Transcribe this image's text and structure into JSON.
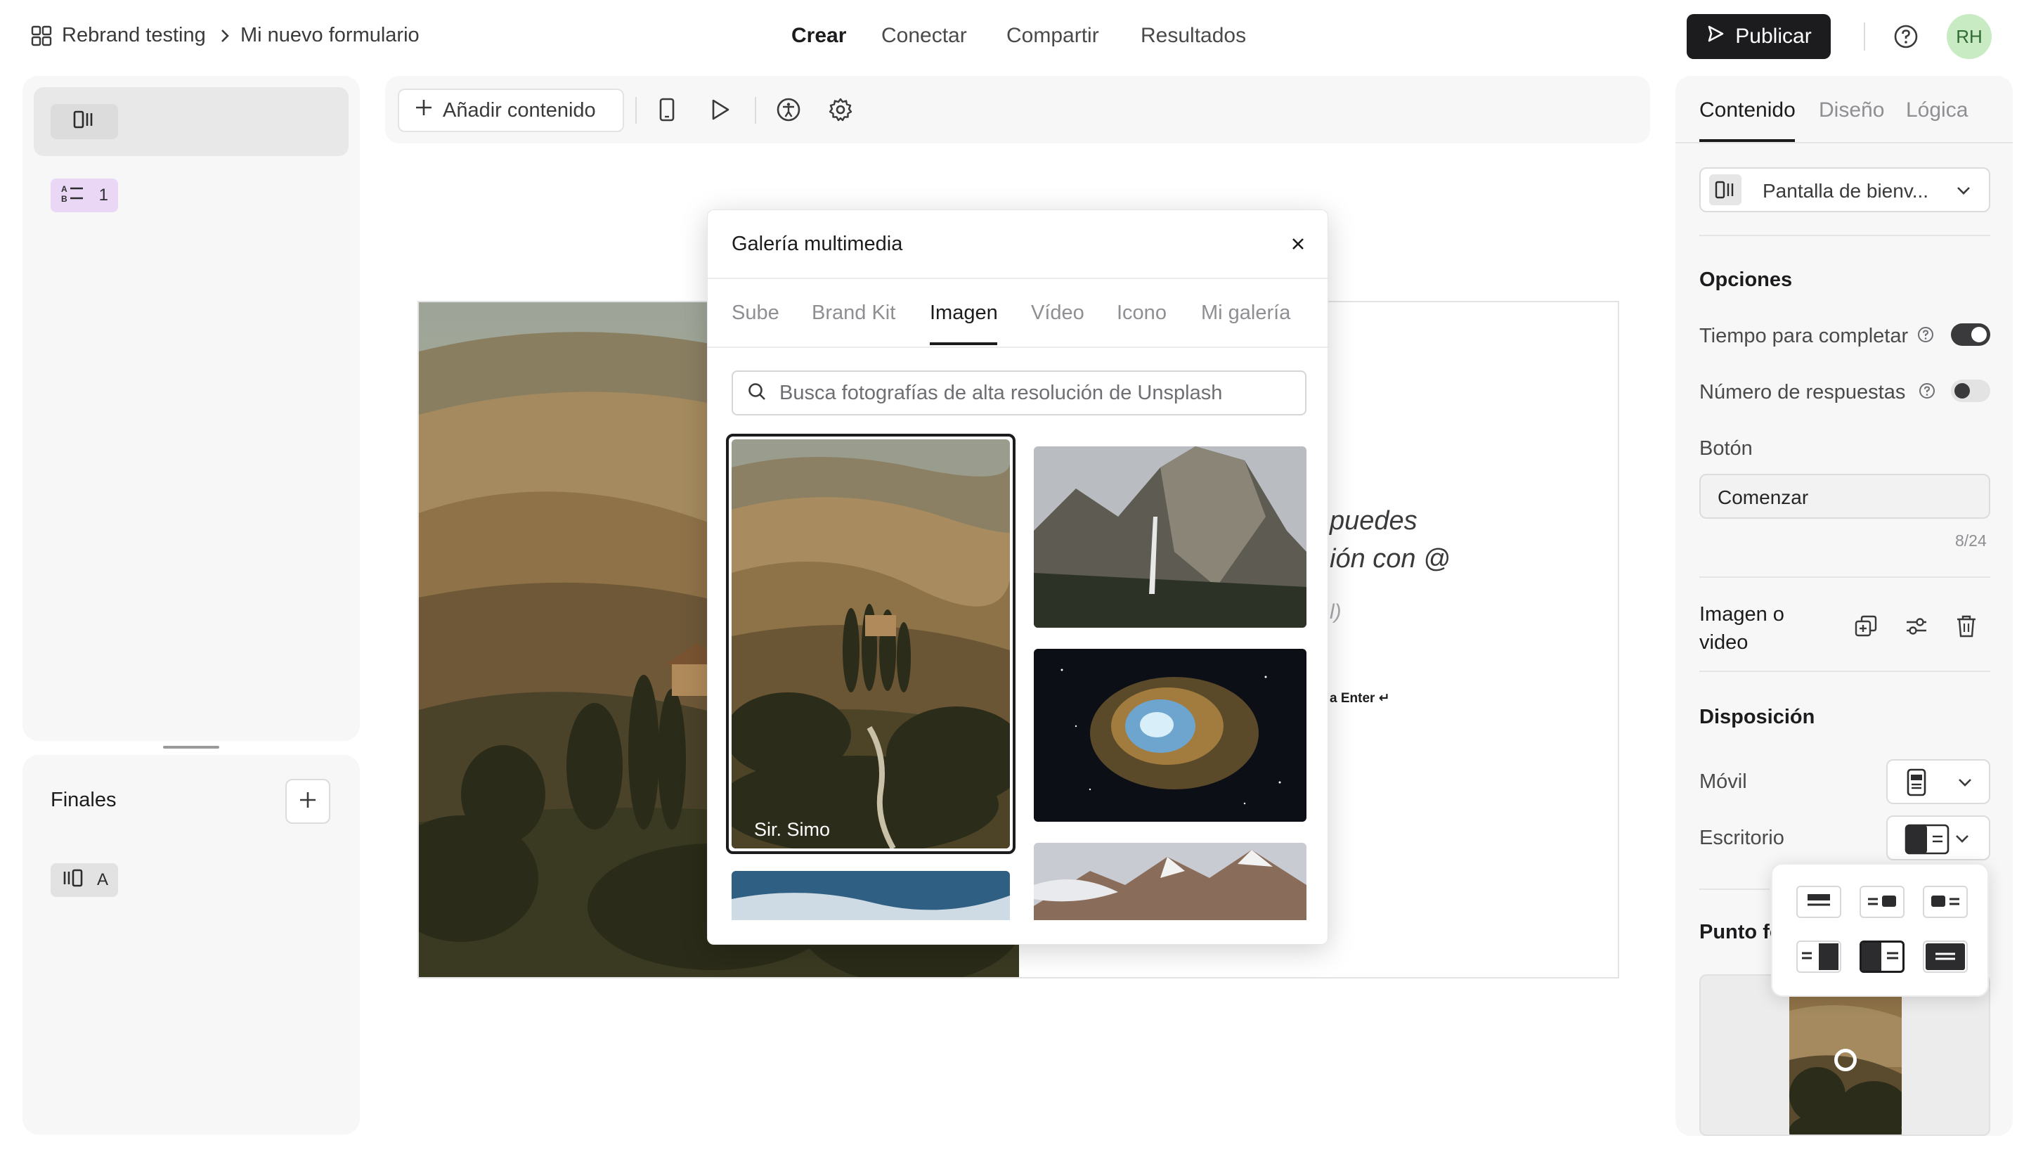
{
  "header": {
    "workspace": "Rebrand testing",
    "form_name": "Mi nuevo formulario",
    "nav": [
      "Crear",
      "Conectar",
      "Compartir",
      "Resultados"
    ],
    "active_nav": "Crear",
    "publish_label": "Publicar",
    "avatar_initials": "RH"
  },
  "left_panel": {
    "question_badge_number": "1",
    "endings_title": "Finales",
    "ending_badge_label": "A"
  },
  "toolbar": {
    "add_content_label": "Añadir contenido"
  },
  "preview": {
    "line1": "puedes",
    "line2": "ión con @",
    "line3": "l)",
    "hint_text": "a Enter ↵"
  },
  "media_gallery": {
    "title": "Galería multimedia",
    "tabs": [
      "Sube",
      "Brand Kit",
      "Imagen",
      "Vídeo",
      "Icono",
      "Mi galería"
    ],
    "active_tab": "Imagen",
    "search_placeholder": "Busca fotografías de alta resolución de Unsplash",
    "images": [
      {
        "name": "tuscany-hills",
        "author": "Sir. Simo",
        "selected": true
      },
      {
        "name": "yosemite-waterfall"
      },
      {
        "name": "nebula"
      },
      {
        "name": "snowy-mountains"
      },
      {
        "name": "blue-sky-clouds"
      }
    ]
  },
  "right_panel": {
    "tabs": [
      "Contenido",
      "Diseño",
      "Lógica"
    ],
    "active_tab": "Contenido",
    "screen_select_value": "Pantalla de bienv...",
    "options_title": "Opciones",
    "time_to_complete_label": "Tiempo para completar",
    "time_to_complete_on": true,
    "responses_count_label": "Número de respuestas",
    "responses_count_on": false,
    "button_label": "Botón",
    "button_value": "Comenzar",
    "button_char_count": "8/24",
    "image_or_video_label": "Imagen o video",
    "layout_title": "Disposición",
    "mobile_label": "Móvil",
    "desktop_label": "Escritorio",
    "focal_point_label": "Punto fo"
  },
  "colors": {
    "accent_dark": "#1c1c1e",
    "avatar_bg": "#c9ebc4",
    "question_badge_bg": "#e9d7f5",
    "panel_bg": "#f7f7f7"
  }
}
